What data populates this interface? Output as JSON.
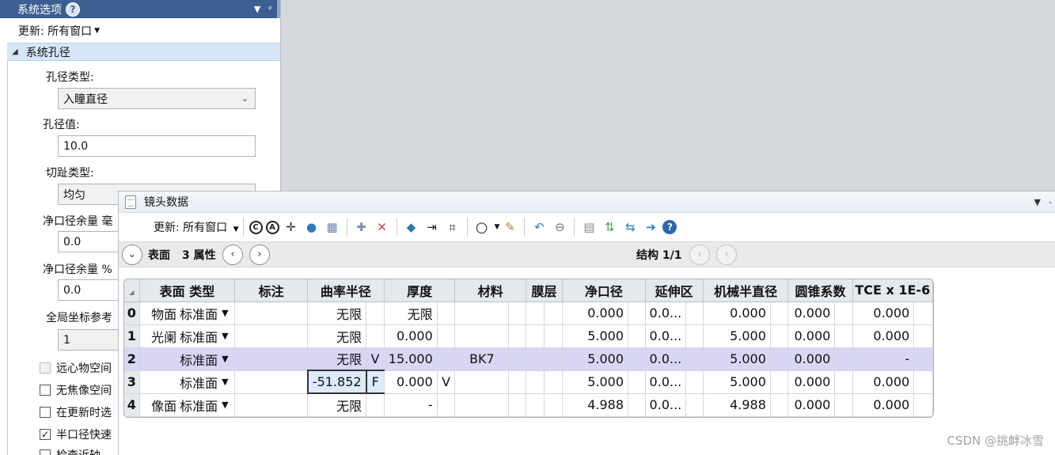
{
  "system_panel": {
    "title": "系统选项",
    "help_icon": "?",
    "controls": [
      "▼",
      "ᵖ"
    ],
    "update_label": "更新: 所有窗口",
    "section_title": "系统孔径",
    "aperture_type_label": "孔径类型:",
    "aperture_type_value": "入瞳直径",
    "aperture_value_label": "孔径值:",
    "aperture_value": "10.0",
    "apodization_label": "切趾类型:",
    "apodization_value": "均匀",
    "clear_margin_mm_label": "净口径余量 毫",
    "clear_margin_mm_value": "0.0",
    "clear_margin_pct_label": "净口径余量 %",
    "clear_margin_pct_value": "0.0",
    "global_ref_label": "全局坐标参考",
    "global_ref_value": "1",
    "checkboxes": [
      {
        "label": "远心物空间",
        "checked": false,
        "disabled": true
      },
      {
        "label": "无焦像空间",
        "checked": false,
        "disabled": false
      },
      {
        "label": "在更新时选",
        "checked": false,
        "disabled": false
      },
      {
        "label": "半口径快速",
        "checked": true,
        "disabled": false
      },
      {
        "label": "检查近轴",
        "checked": false,
        "disabled": false
      }
    ]
  },
  "lens_window": {
    "title": "镜头数据",
    "controls": [
      "▼",
      "-"
    ],
    "toolbar": {
      "update_label": "更新: 所有窗口"
    },
    "nav": {
      "surface_label": "表面",
      "surface_props": "3 属性",
      "config_label": "结构 1/1"
    },
    "grid": {
      "headers": [
        "表面 类型",
        "标注",
        "曲率半径",
        "厚度",
        "材料",
        "膜层",
        "净口径",
        "延伸区",
        "机械半直径",
        "圆锥系数",
        "TCE x 1E-6"
      ],
      "rows": [
        {
          "n": "0",
          "prefix": "物面",
          "type": "标准面",
          "comment": "",
          "radius": "无限",
          "radius_sol": "",
          "thickness": "无限",
          "thickness_sol": "",
          "material": "",
          "coating": "",
          "clear": "0.000",
          "chip": "0.0...",
          "mech": "0.000",
          "conic": "0.000",
          "tce": "0.000"
        },
        {
          "n": "1",
          "prefix": "光阑",
          "type": "标准面",
          "comment": "",
          "radius": "无限",
          "radius_sol": "",
          "thickness": "0.000",
          "thickness_sol": "",
          "material": "",
          "coating": "",
          "clear": "5.000",
          "chip": "0.0...",
          "mech": "5.000",
          "conic": "0.000",
          "tce": "0.000"
        },
        {
          "n": "2",
          "prefix": "",
          "type": "标准面",
          "comment": "",
          "radius": "无限",
          "radius_sol": "V",
          "thickness": "15.000",
          "thickness_sol": "",
          "material": "BK7",
          "coating": "",
          "clear": "5.000",
          "chip": "0.0...",
          "mech": "5.000",
          "conic": "0.000",
          "tce": "-"
        },
        {
          "n": "3",
          "prefix": "",
          "type": "标准面",
          "comment": "",
          "radius": "-51.852",
          "radius_sol": "F",
          "thickness": "0.000",
          "thickness_sol": "V",
          "material": "",
          "coating": "",
          "clear": "5.000",
          "chip": "0.0...",
          "mech": "5.000",
          "conic": "0.000",
          "tce": "0.000"
        },
        {
          "n": "4",
          "prefix": "像面",
          "type": "标准面",
          "comment": "",
          "radius": "无限",
          "radius_sol": "",
          "thickness": "-",
          "thickness_sol": "",
          "material": "",
          "coating": "",
          "clear": "4.988",
          "chip": "0.0...",
          "mech": "4.988",
          "conic": "0.000",
          "tce": "0.000"
        }
      ]
    }
  },
  "watermark": "CSDN @挑衅冰雪"
}
